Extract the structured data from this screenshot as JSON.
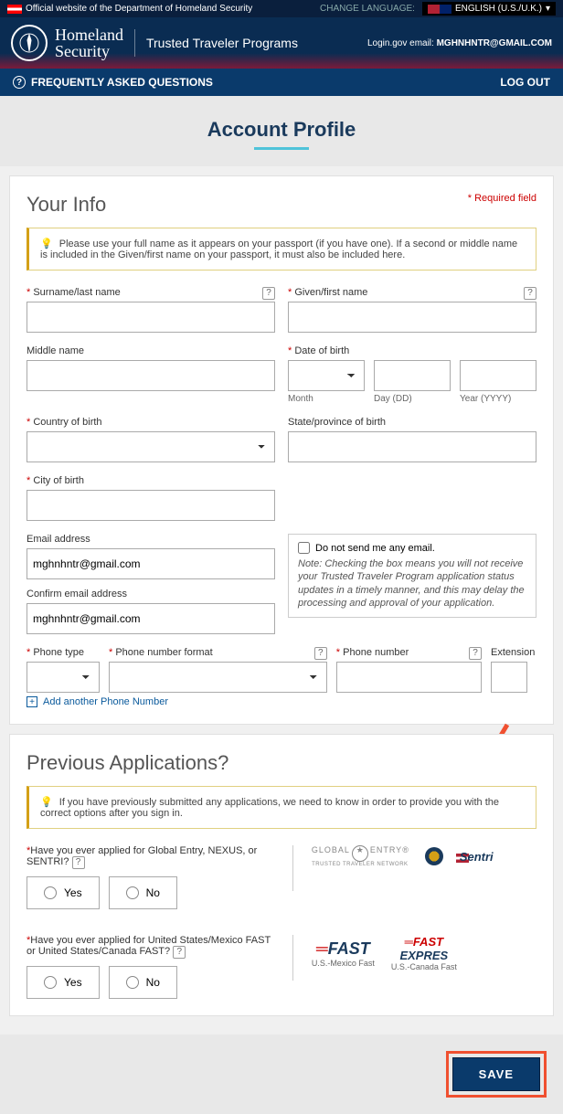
{
  "topbar": {
    "official": "Official website of the Department of Homeland Security",
    "change_lang": "CHANGE LANGUAGE:",
    "lang": "ENGLISH (U.S./U.K.)"
  },
  "header": {
    "hs1": "Homeland",
    "hs2": "Security",
    "ttp": "Trusted Traveler Programs",
    "login_label": "Login.gov email:",
    "login_email": "MGHNHNTR@GMAIL.COM"
  },
  "nav": {
    "faq": "FREQUENTLY ASKED QUESTIONS",
    "logout": "LOG OUT"
  },
  "page_title": "Account Profile",
  "your_info": {
    "title": "Your Info",
    "required": "* Required field",
    "note": "Please use your full name as it appears on your passport (if you have one). If a second or middle name is included in the Given/first name on your passport, it must also be included here.",
    "surname": "Surname/last name",
    "given": "Given/first name",
    "middle": "Middle name",
    "dob": "Date of birth",
    "month": "Month",
    "day": "Day (DD)",
    "year": "Year (YYYY)",
    "country": "Country of birth",
    "state": "State/province of birth",
    "city": "City of birth",
    "email": "Email address",
    "email_val": "mghnhntr@gmail.com",
    "confirm_email": "Confirm email address",
    "confirm_email_val": "mghnhntr@gmail.com",
    "no_email": "Do not send me any email.",
    "no_email_note": "Note: Checking the box means you will not receive your Trusted Traveler Program application status updates in a timely manner, and this may delay the processing and approval of your application.",
    "phone_type": "Phone type",
    "phone_fmt": "Phone number format",
    "phone_num": "Phone number",
    "ext": "Extension",
    "add_phone": "Add another Phone Number"
  },
  "prev": {
    "title": "Previous Applications?",
    "note": "If you have previously submitted any applications, we need to know in order to provide you with the correct options after you sign in.",
    "q1": "Have you ever applied for Global Entry, NEXUS, or SENTRI?",
    "q2": "Have you ever applied for United States/Mexico FAST or United States/Canada FAST?",
    "yes": "Yes",
    "no": "No",
    "ge1": "GLOBAL",
    "ge2": "ENTRY",
    "ge_sub": "TRUSTED TRAVELER NETWORK",
    "sentri": "Sentri",
    "fast": "FAST",
    "fast_sub1": "U.S.-Mexico Fast",
    "fast2a": "FAST",
    "fast2b": "EXPRES",
    "fast_sub2": "U.S.-Canada Fast"
  },
  "save": "SAVE"
}
